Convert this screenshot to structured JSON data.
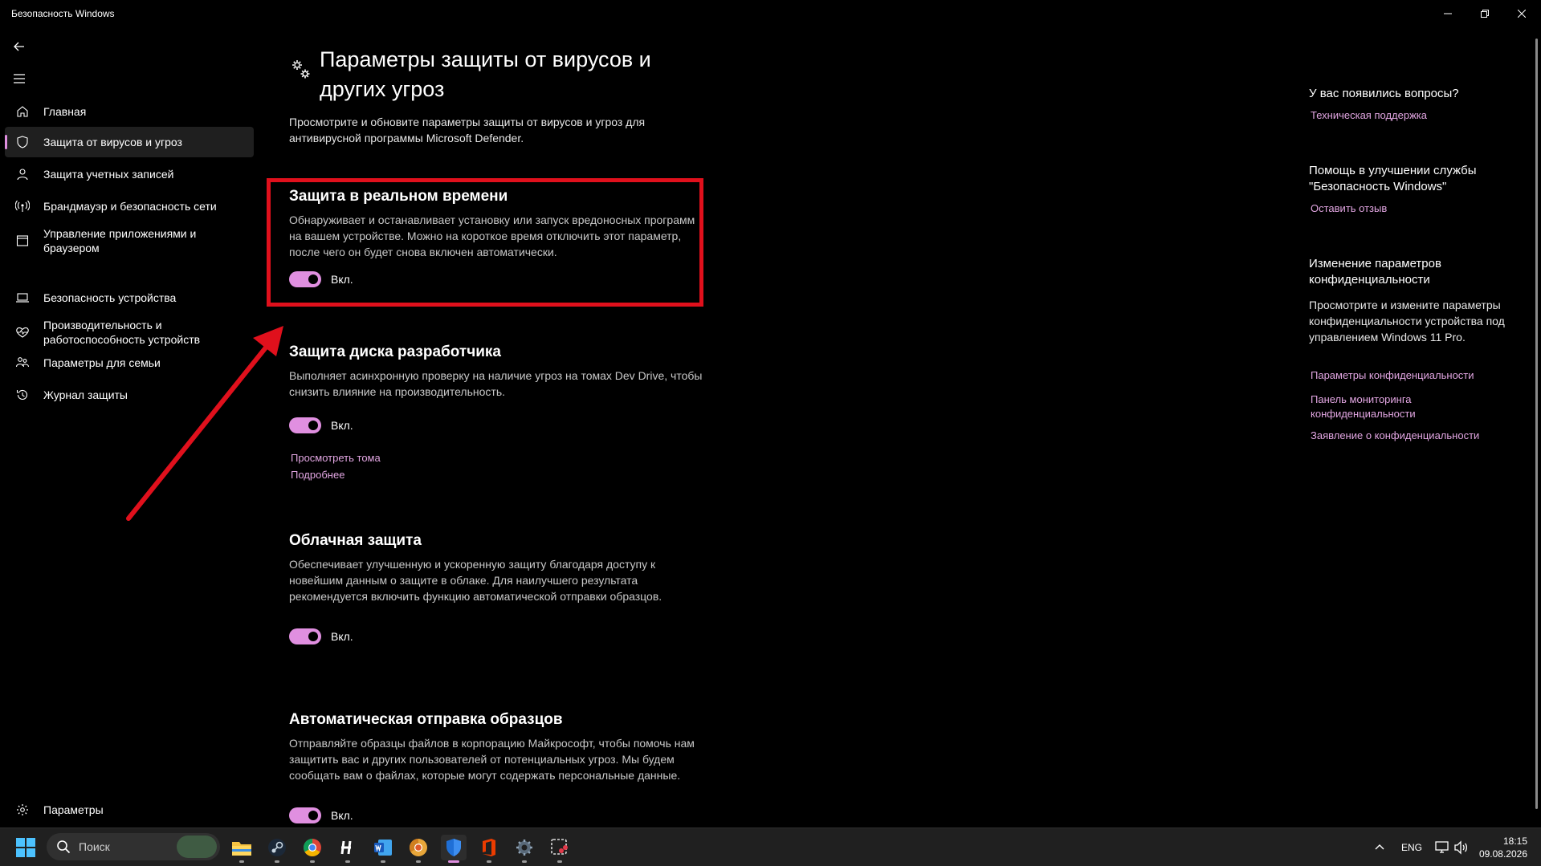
{
  "window": {
    "title": "Безопасность Windows"
  },
  "sidebar": {
    "items": [
      {
        "label": "Главная",
        "icon": "home-icon"
      },
      {
        "label": "Защита от вирусов и угроз",
        "icon": "shield-icon",
        "active": true
      },
      {
        "label": "Защита учетных записей",
        "icon": "person-icon"
      },
      {
        "label": "Брандмауэр и безопасность сети",
        "icon": "antenna-icon"
      },
      {
        "label": "Управление приложениями и браузером",
        "icon": "app-browser-icon"
      },
      {
        "label": "Безопасность устройства",
        "icon": "laptop-icon"
      },
      {
        "label": "Производительность и работоспособность устройств",
        "icon": "heart-pulse-icon"
      },
      {
        "label": "Параметры для семьи",
        "icon": "family-icon"
      },
      {
        "label": "Журнал защиты",
        "icon": "history-icon"
      }
    ],
    "settings_label": "Параметры"
  },
  "main": {
    "title": "Параметры защиты от вирусов и других угроз",
    "description": "Просмотрите и обновите параметры защиты от вирусов и угроз для антивирусной программы Microsoft Defender.",
    "sections": [
      {
        "title": "Защита в реальном времени",
        "description": "Обнаруживает и останавливает установку или запуск вредоносных программ на вашем устройстве. Можно на короткое время отключить этот параметр, после чего он будет снова включен автоматически.",
        "toggle_label": "Вкл.",
        "toggle_on": true
      },
      {
        "title": "Защита диска разработчика",
        "description": "Выполняет асинхронную проверку на наличие угроз на томах Dev Drive, чтобы снизить влияние на производительность.",
        "toggle_label": "Вкл.",
        "toggle_on": true,
        "links": [
          "Просмотреть тома",
          "Подробнее"
        ]
      },
      {
        "title": "Облачная защита",
        "description": "Обеспечивает улучшенную и ускоренную защиту благодаря доступу к новейшим данным о защите в облаке. Для наилучшего результата рекомендуется включить функцию автоматической отправки образцов.",
        "toggle_label": "Вкл.",
        "toggle_on": true
      },
      {
        "title": "Автоматическая отправка образцов",
        "description": "Отправляйте образцы файлов в корпорацию Майкрософт, чтобы помочь нам защитить вас и других пользователей от потенциальных угроз. Мы будем сообщать вам о файлах, которые могут содержать персональные данные.",
        "toggle_label": "Вкл.",
        "toggle_on": true
      }
    ]
  },
  "right_panel": {
    "questions_title": "У вас появились вопросы?",
    "support_link": "Техническая поддержка",
    "improve_title": "Помощь в улучшении службы \"Безопасность Windows\"",
    "feedback_link": "Оставить отзыв",
    "privacy_title": "Изменение параметров конфиденциальности",
    "privacy_text": "Просмотрите и измените параметры конфиденциальности устройства под управлением Windows 11 Pro.",
    "privacy_links": [
      "Параметры конфиденциальности",
      "Панель мониторинга конфиденциальности",
      "Заявление о конфиденциальности"
    ]
  },
  "taskbar": {
    "search_placeholder": "Поиск",
    "language": "ENG",
    "time": "18:15",
    "date": "09.08.2026",
    "apps": [
      "file-explorer-icon",
      "steam-icon",
      "chrome-icon",
      "h-app-icon",
      "word-icon",
      "chrome-canary-icon",
      "windows-security-icon",
      "office-icon",
      "settings-gear-icon",
      "snipping-tool-icon"
    ]
  },
  "colors": {
    "accent": "#e08fe0",
    "link": "#e2a6e2",
    "highlight": "#e0101c",
    "background": "#000000",
    "taskbar": "#202020"
  }
}
